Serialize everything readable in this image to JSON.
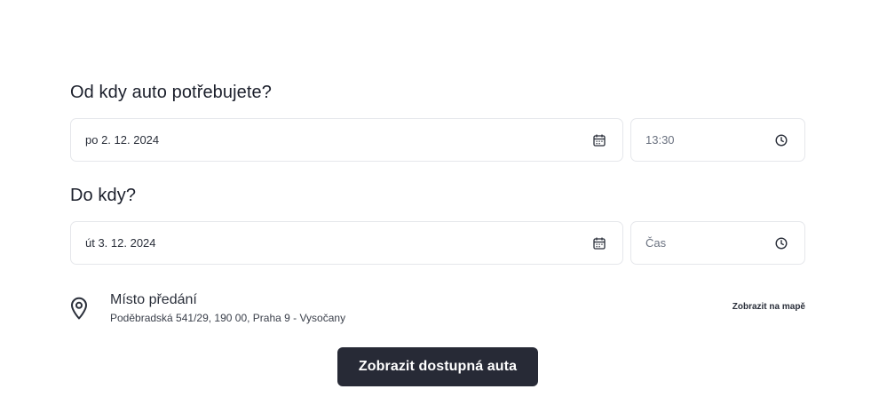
{
  "from_section": {
    "title": "Od kdy auto potřebujete?",
    "date_value": "po 2. 12. 2024",
    "date_icon": "calendar-icon",
    "time_value": "13:30",
    "time_icon": "clock-icon"
  },
  "to_section": {
    "title": "Do kdy?",
    "date_value": "út 3. 12. 2024",
    "date_icon": "calendar-icon",
    "time_placeholder": "Čas",
    "time_icon": "clock-icon"
  },
  "location": {
    "icon": "map-pin-icon",
    "title": "Místo předání",
    "address": "Poděbradská 541/29, 190 00, Praha 9 - Vysočany",
    "map_link": "Zobrazit na mapě"
  },
  "submit": {
    "label": "Zobrazit dostupná auta",
    "background": "#272a36"
  }
}
